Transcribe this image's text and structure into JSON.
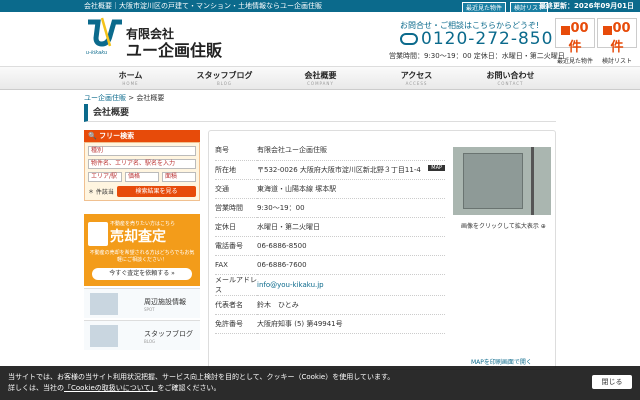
{
  "topbar": {
    "text": "会社概要｜大阪市淀川区の戸建て・マンション・土地情報ならユー企画住販",
    "updated": "最終更新：2026年09月01日"
  },
  "header": {
    "logo_text": "u-kikaku",
    "company_line1": "有限会社",
    "company_line2": "ユー企画住販",
    "contact_lead": "お問合せ・ご相談はこちらからどうぞ!",
    "phone": "0120-272-850",
    "hours": "営業時間：9:30〜19：00 定休日：水曜日・第二火曜日",
    "util_recent": "最近見た物件",
    "util_list": "検討リスト",
    "recent_count": "00件",
    "recent_label": "最近見た物件",
    "list_count": "00件",
    "list_label": "検討リスト"
  },
  "nav": [
    {
      "jp": "ホーム",
      "en": "HOME"
    },
    {
      "jp": "スタッフブログ",
      "en": "BLOG"
    },
    {
      "jp": "会社概要",
      "en": "COMPANY"
    },
    {
      "jp": "アクセス",
      "en": "ACCESS"
    },
    {
      "jp": "お問い合わせ",
      "en": "CONTACT"
    }
  ],
  "breadcrumb": {
    "home": "ユー企画住販",
    "sep": ">",
    "current": "会社概要"
  },
  "page_title": "会社概要",
  "sidebar": {
    "search_title": "フリー検索",
    "type_placeholder": "種別",
    "keyword_placeholder": "物件名、エリア名、駅名を入力",
    "area_placeholder": "エリア/駅",
    "price_placeholder": "価格",
    "size_placeholder": "面積",
    "hint": "＊ 件該当",
    "search_button": "検索結果を見る",
    "sale_lead": "不動産を売りたい方はこちら",
    "sale_title": "売却査定",
    "sale_text": "不動産の売却を希望される方はどちらでもお気軽にご相談ください！",
    "sale_button": "今すぐ査定を依頼する »",
    "banner1_jp": "周辺施設情報",
    "banner1_en": "SPOT",
    "banner2_jp": "スタッフブログ",
    "banner2_en": "BLOG"
  },
  "company": {
    "rows": [
      {
        "k": "商号",
        "v": "有限会社ユー企画住販"
      },
      {
        "k": "所在地",
        "v": "〒532-0026 大阪府大阪市淀川区新北野３丁目11-4"
      },
      {
        "k": "交通",
        "v": "東海道・山陽本線 塚本駅"
      },
      {
        "k": "営業時間",
        "v": "9:30〜19：00"
      },
      {
        "k": "定休日",
        "v": "水曜日・第二火曜日"
      },
      {
        "k": "電話番号",
        "v": "06-6886-8500"
      },
      {
        "k": "FAX",
        "v": "06-6886-7600"
      },
      {
        "k": "メールアドレス",
        "v": "info@you-kikaku.jp"
      },
      {
        "k": "代表者名",
        "v": "鈴木　ひとみ"
      },
      {
        "k": "免許番号",
        "v": "大阪府知事 (5) 第49941号"
      }
    ],
    "map_button": "MAP",
    "photo_caption": "画像をクリックして拡大表示",
    "map_note": "MAPを印刷画面で開く"
  },
  "cookie": {
    "line1": "当サイトでは、お客様の当サイト利用状況把握、サービス向上検討を目的として、クッキー（Cookie）を使用しています。",
    "line2_pre": "詳しくは、当社の",
    "line2_link": "「Cookieの取扱いについて」",
    "line2_post": "をご確認ください。",
    "close": "閉じる"
  }
}
